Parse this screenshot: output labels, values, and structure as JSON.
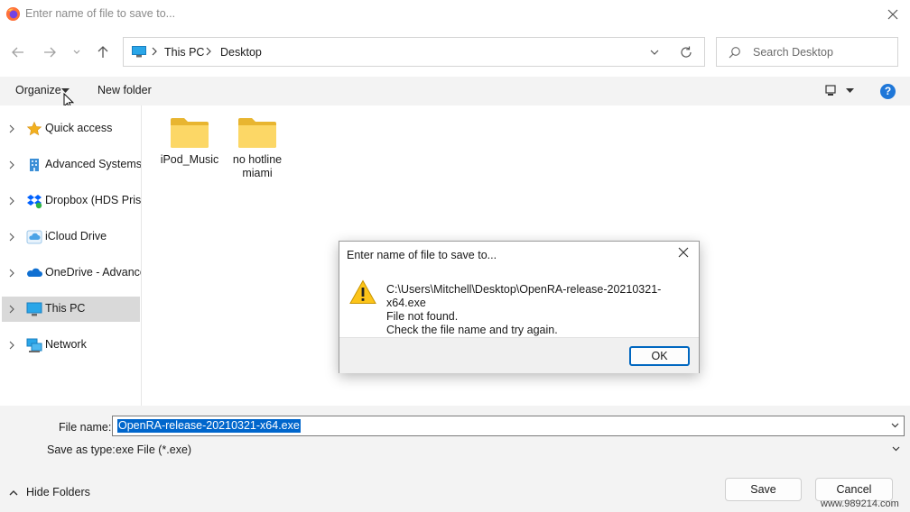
{
  "window": {
    "title": "Enter name of file to save to..."
  },
  "address": {
    "crumbs": [
      "This PC",
      "Desktop"
    ]
  },
  "search": {
    "placeholder": "Search Desktop"
  },
  "toolbar": {
    "organize": "Organize",
    "new_folder": "New folder",
    "help": "?"
  },
  "nav": {
    "items": [
      {
        "label": "Quick access",
        "icon": "star-icon"
      },
      {
        "label": "Advanced Systems I",
        "icon": "building-icon"
      },
      {
        "label": "Dropbox (HDS Prism",
        "icon": "dropbox-icon"
      },
      {
        "label": "iCloud Drive",
        "icon": "icloud-icon"
      },
      {
        "label": "OneDrive - Advance",
        "icon": "onedrive-icon"
      },
      {
        "label": "This PC",
        "icon": "pc-icon",
        "selected": true
      },
      {
        "label": "Network",
        "icon": "network-icon"
      }
    ]
  },
  "folders": [
    {
      "label": "iPod_Music"
    },
    {
      "label": "no hotline miami"
    }
  ],
  "bottom": {
    "file_name_label": "File name:",
    "file_name_value": "OpenRA-release-20210321-x64.exe",
    "save_type_label": "Save as type:",
    "save_type_value": "exe File (*.exe)",
    "hide_folders": "Hide Folders",
    "save_label": "Save",
    "cancel_label": "Cancel",
    "watermark": "www.989214.com"
  },
  "dialog": {
    "title": "Enter name of file to save to...",
    "line1": "C:\\Users\\Mitchell\\Desktop\\OpenRA-release-20210321-x64.exe",
    "line2": "File not found.",
    "line3": "Check the file name and try again.",
    "ok_label": "OK"
  },
  "colors": {
    "accent": "#0067c0",
    "selection": "#0066cc",
    "folder": "#f8d05a",
    "help": "#1f77d8"
  }
}
